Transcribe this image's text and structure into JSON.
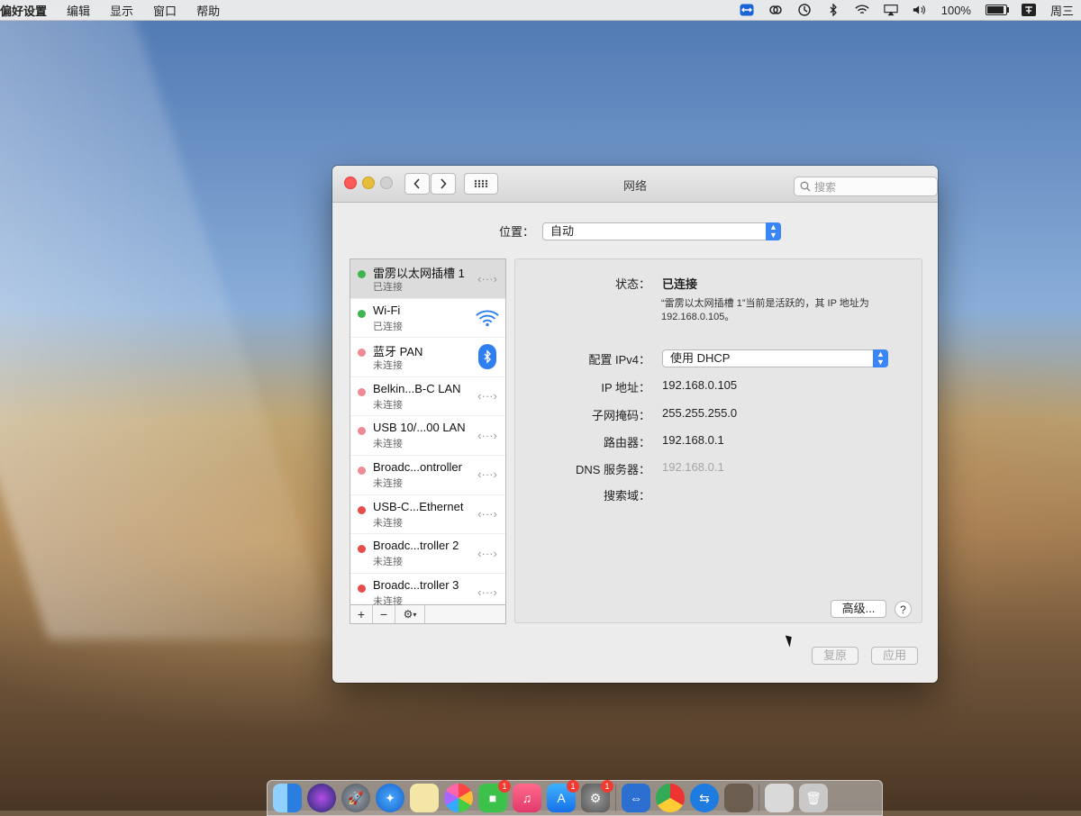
{
  "menubar": {
    "menus": [
      "偏好设置",
      "编辑",
      "显示",
      "窗口",
      "帮助"
    ],
    "battery_percent": "100%",
    "battery_level": 1.0,
    "clock": "周三"
  },
  "window": {
    "title": "网络",
    "search_placeholder": "搜索",
    "location_label": "位置：",
    "location_value": "自动"
  },
  "services": [
    {
      "name": "雷雳以太网插槽 1",
      "state": "已连接",
      "status_color": "#3fb34f",
      "icon": "ethernet-icon",
      "selected": true
    },
    {
      "name": "Wi-Fi",
      "state": "已连接",
      "status_color": "#3fb34f",
      "icon": "wifi-icon"
    },
    {
      "name": "蓝牙 PAN",
      "state": "未连接",
      "status_color": "#ef8a94",
      "icon": "bluetooth-icon"
    },
    {
      "name": "Belkin...B-C LAN",
      "state": "未连接",
      "status_color": "#ef8a94",
      "icon": "ethernet-icon"
    },
    {
      "name": "USB 10/...00 LAN",
      "state": "未连接",
      "status_color": "#ef8a94",
      "icon": "ethernet-icon"
    },
    {
      "name": "Broadc...ontroller",
      "state": "未连接",
      "status_color": "#ef8a94",
      "icon": "ethernet-icon"
    },
    {
      "name": "USB-C...Ethernet",
      "state": "未连接",
      "status_color": "#e84b4b",
      "icon": "ethernet-icon"
    },
    {
      "name": "Broadc...troller 2",
      "state": "未连接",
      "status_color": "#e84b4b",
      "icon": "ethernet-icon"
    },
    {
      "name": "Broadc...troller 3",
      "state": "未连接",
      "status_color": "#e84b4b",
      "icon": "ethernet-icon"
    }
  ],
  "detail": {
    "status_label": "状态：",
    "status_value": "已连接",
    "status_note": "“雷雳以太网插槽 1”当前是活跃的，其 IP 地址为 192.168.0.105。",
    "ipv4_label": "配置 IPv4：",
    "ipv4_value": "使用 DHCP",
    "ip_label": "IP 地址：",
    "ip_value": "192.168.0.105",
    "subnet_label": "子网掩码：",
    "subnet_value": "255.255.255.0",
    "router_label": "路由器：",
    "router_value": "192.168.0.1",
    "dns_label": "DNS 服务器：",
    "dns_value": "192.168.0.1",
    "search_domain_label": "搜索域：",
    "advanced_button": "高级...",
    "help_button": "?"
  },
  "footer": {
    "revert_button": "复原",
    "apply_button": "应用"
  },
  "dock": {
    "badges": {
      "facetime": "1",
      "appstore": "1",
      "sysprefs": "1"
    }
  }
}
